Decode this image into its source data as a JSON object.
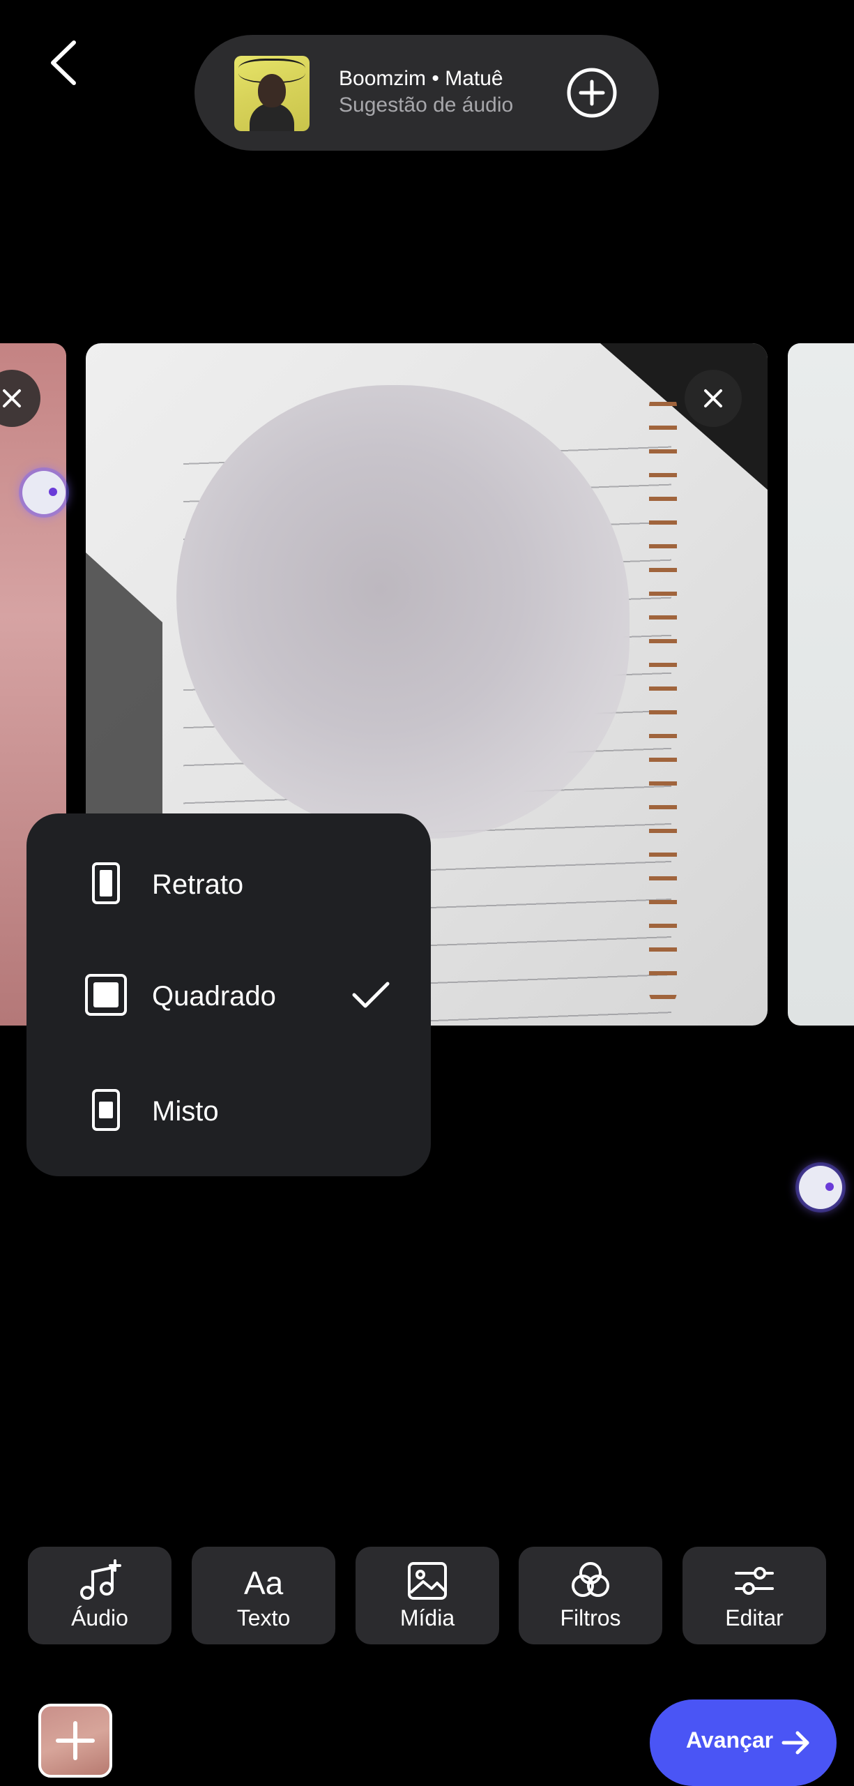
{
  "header": {
    "song_title": "Boomzim • Matuê",
    "song_subtitle": "Sugestão de áudio"
  },
  "format_menu": {
    "items": [
      {
        "label": "Retrato",
        "selected": false
      },
      {
        "label": "Quadrado",
        "selected": true
      },
      {
        "label": "Misto",
        "selected": false
      }
    ]
  },
  "toolbar": {
    "audio": "Áudio",
    "text": "Texto",
    "media": "Mídia",
    "filters": "Filtros",
    "edit": "Editar"
  },
  "footer": {
    "next_label": "Avançar"
  },
  "colors": {
    "accent": "#4a55f5",
    "menu_bg": "#1f2023",
    "tool_bg": "#2b2b2e"
  },
  "icons": [
    "back-icon",
    "plus-circle-icon",
    "close-icon",
    "crop-icon",
    "portrait-icon",
    "square-icon",
    "mixed-icon",
    "check-icon",
    "music-add-icon",
    "text-icon",
    "image-icon",
    "filters-icon",
    "sliders-icon",
    "plus-icon",
    "arrow-right-icon"
  ]
}
